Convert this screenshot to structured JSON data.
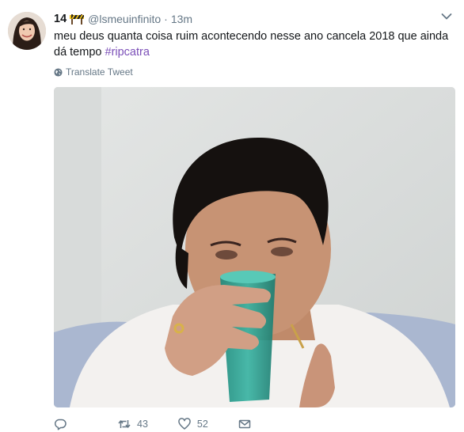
{
  "tweet": {
    "display_name": "14",
    "name_badge_icon": "construction-sign-icon",
    "handle": "@lsmeuinfinito",
    "separator": "·",
    "time": "13m",
    "text": "meu deus quanta coisa ruim acontecendo nesse ano cancela 2018 que ainda dá tempo ",
    "hashtag": "#ripcatra",
    "translate_label": "Translate Tweet",
    "retweet_count": "43",
    "like_count": "52"
  },
  "colors": {
    "hashtag": "#7b4fb8",
    "secondary_text": "#657786",
    "primary_text": "#14171a"
  }
}
